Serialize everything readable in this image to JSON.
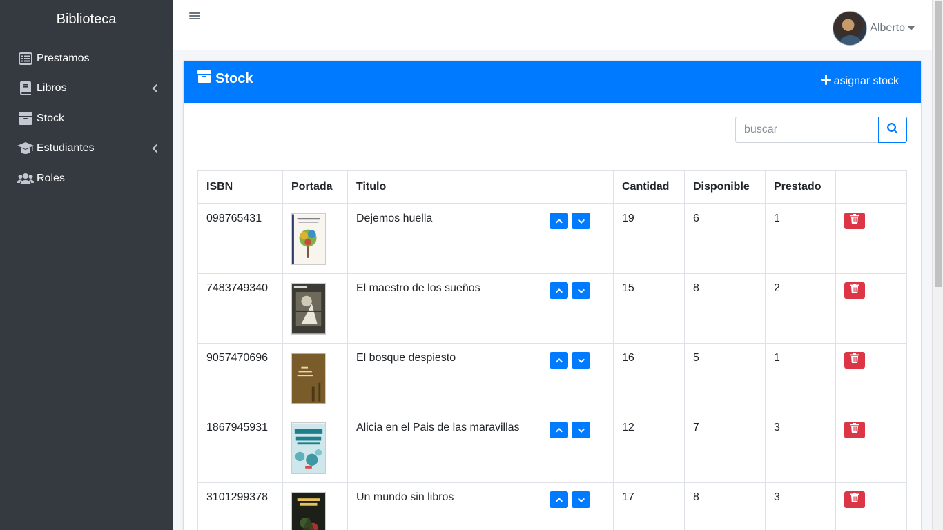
{
  "sidebar": {
    "brand": "Biblioteca",
    "items": [
      {
        "label": "Prestamos",
        "icon": "list-icon"
      },
      {
        "label": "Libros",
        "icon": "book-icon"
      },
      {
        "label": "Stock",
        "icon": "archive-icon"
      },
      {
        "label": "Estudiantes",
        "icon": "graduation-cap-icon"
      },
      {
        "label": "Roles",
        "icon": "users-icon"
      }
    ]
  },
  "header": {
    "user_name": "Alberto"
  },
  "card": {
    "title": "Stock",
    "assign_label": "asignar stock"
  },
  "search": {
    "placeholder": "buscar"
  },
  "table": {
    "columns": [
      "ISBN",
      "Portada",
      "Titulo",
      "",
      "Cantidad",
      "Disponible",
      "Prestado",
      ""
    ],
    "rows": [
      {
        "isbn": "098765431",
        "title": "Dejemos huella",
        "cantidad": "19",
        "disponible": "6",
        "prestado": "1"
      },
      {
        "isbn": "7483749340",
        "title": "El maestro de los sueños",
        "cantidad": "15",
        "disponible": "8",
        "prestado": "2"
      },
      {
        "isbn": "9057470696",
        "title": "El bosque despiesto",
        "cantidad": "16",
        "disponible": "5",
        "prestado": "1"
      },
      {
        "isbn": "1867945931",
        "title": "Alicia en el Pais de las maravillas",
        "cantidad": "12",
        "disponible": "7",
        "prestado": "3"
      },
      {
        "isbn": "3101299378",
        "title": "Un mundo sin libros",
        "cantidad": "17",
        "disponible": "8",
        "prestado": "3"
      }
    ]
  },
  "colors": {
    "primary": "#007bff",
    "danger": "#dc3545",
    "sidebar_bg": "#343a40"
  }
}
